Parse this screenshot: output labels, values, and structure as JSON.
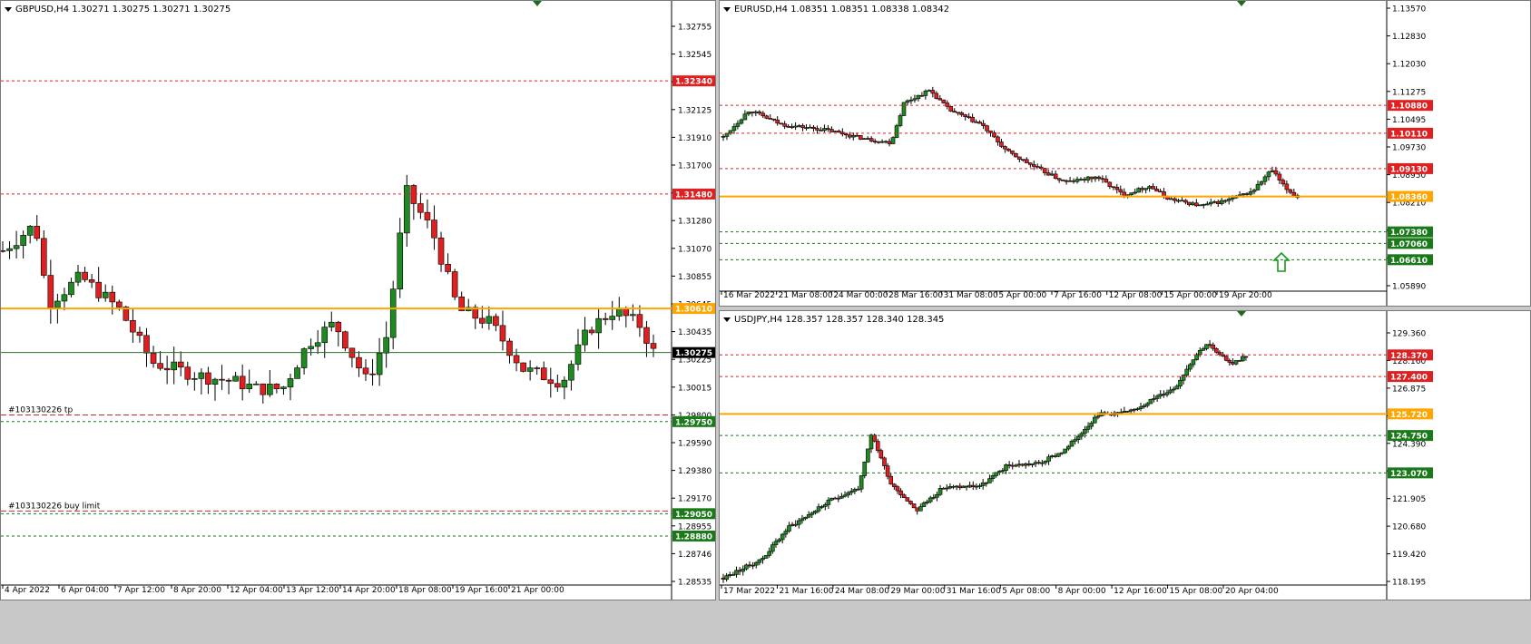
{
  "colors": {
    "bull": "#1f8a1f",
    "bear": "#e02020",
    "resistance_line": "#e02020",
    "support_line": "#1a7a1a",
    "pivot_line": "#ffa500",
    "price_line": "#2e6b2e",
    "shift_marker": "#1e6b1e"
  },
  "charts": [
    {
      "id": "gbpusd",
      "header": "GBPUSD,H4  1.30271 1.30275 1.30271 1.30275",
      "price_ticks": [
        "1.32755",
        "1.32545",
        "1.32335",
        "1.32125",
        "1.31910",
        "1.31700",
        "1.31490",
        "1.31280",
        "1.31070",
        "1.30855",
        "1.30645",
        "1.30435",
        "1.30225",
        "1.30015",
        "1.29800",
        "1.29590",
        "1.29380",
        "1.29170",
        "1.28955",
        "1.28746",
        "1.28535"
      ],
      "time_ticks": [
        "4 Apr 2022",
        "6 Apr 04:00",
        "7 Apr 12:00",
        "8 Apr 20:00",
        "12 Apr 04:00",
        "13 Apr 12:00",
        "14 Apr 20:00",
        "18 Apr 08:00",
        "19 Apr 16:00",
        "21 Apr 00:00"
      ],
      "levels": [
        {
          "price": 1.3234,
          "label": "1.32340",
          "kind": "resistance"
        },
        {
          "price": 1.3148,
          "label": "1.31480",
          "kind": "resistance"
        },
        {
          "price": 1.3061,
          "label": "1.30610",
          "kind": "pivot"
        },
        {
          "price": 1.30275,
          "label": "1.30275",
          "kind": "price"
        },
        {
          "price": 1.2975,
          "label": "1.29750",
          "kind": "support"
        },
        {
          "price": 1.2905,
          "label": "1.29050",
          "kind": "support"
        },
        {
          "price": 1.2888,
          "label": "1.28880",
          "kind": "support"
        }
      ],
      "order_labels": [
        {
          "text": "#103130226 tp",
          "price": 1.298
        },
        {
          "text": "#103130226 buy limit",
          "price": 1.2907
        }
      ]
    },
    {
      "id": "eurusd",
      "header": "EURUSD,H4  1.08351 1.08351 1.08338 1.08342",
      "price_ticks": [
        "1.13570",
        "1.12830",
        "1.12030",
        "1.11275",
        "1.10495",
        "1.09730",
        "1.08950",
        "1.08210",
        "1.07430",
        "1.06660",
        "1.05890"
      ],
      "time_ticks": [
        "16 Mar 2022",
        "21 Mar 08:00",
        "24 Mar 00:00",
        "28 Mar 16:00",
        "31 Mar 08:00",
        "5 Apr 00:00",
        "7 Apr 16:00",
        "12 Apr 08:00",
        "15 Apr 00:00",
        "19 Apr 20:00"
      ],
      "levels": [
        {
          "price": 1.1088,
          "label": "1.10880",
          "kind": "resistance"
        },
        {
          "price": 1.1011,
          "label": "1.10110",
          "kind": "resistance"
        },
        {
          "price": 1.0913,
          "label": "1.09130",
          "kind": "resistance"
        },
        {
          "price": 1.0836,
          "label": "1.08360",
          "kind": "pivot"
        },
        {
          "price": 1.0738,
          "label": "1.07380",
          "kind": "support"
        },
        {
          "price": 1.0706,
          "label": "1.07060",
          "kind": "support"
        },
        {
          "price": 1.0661,
          "label": "1.06610",
          "kind": "support"
        }
      ]
    },
    {
      "id": "usdjpy",
      "header": "USDJPY,H4  128.357 128.357 128.340 128.345",
      "price_ticks": [
        "129.360",
        "128.160",
        "126.875",
        "125.670",
        "124.390",
        "123.185",
        "121.905",
        "120.680",
        "119.420",
        "118.195"
      ],
      "time_ticks": [
        "17 Mar 2022",
        "21 Mar 16:00",
        "24 Mar 08:00",
        "29 Mar 00:00",
        "31 Mar 16:00",
        "5 Apr 08:00",
        "8 Apr 00:00",
        "12 Apr 16:00",
        "15 Apr 08:00",
        "20 Apr 04:00"
      ],
      "levels": [
        {
          "price": 128.37,
          "label": "128.370",
          "kind": "resistance"
        },
        {
          "price": 127.4,
          "label": "127.400",
          "kind": "resistance"
        },
        {
          "price": 125.72,
          "label": "125.720",
          "kind": "pivot"
        },
        {
          "price": 124.75,
          "label": "124.750",
          "kind": "support"
        },
        {
          "price": 123.07,
          "label": "123.070",
          "kind": "support"
        }
      ]
    }
  ]
}
